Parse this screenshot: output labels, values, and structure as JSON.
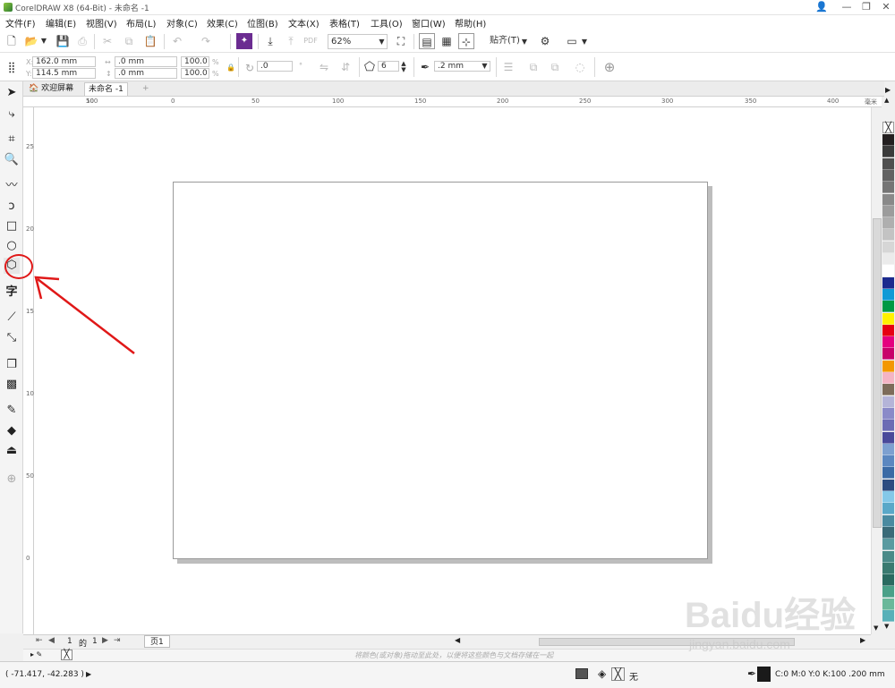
{
  "titlebar": {
    "title": "CorelDRAW X8 (64-Bit) - 未命名 -1",
    "btn_user": "👤",
    "btn_min": "—",
    "btn_restore": "❐",
    "btn_close": "✕"
  },
  "menu": [
    "文件(F)",
    "编辑(E)",
    "视图(V)",
    "布局(L)",
    "对象(C)",
    "效果(C)",
    "位图(B)",
    "文本(X)",
    "表格(T)",
    "工具(O)",
    "窗口(W)",
    "帮助(H)"
  ],
  "toolbar": {
    "zoom": "62%",
    "snap": "贴齐(T)"
  },
  "propbar": {
    "x": "162.0 mm",
    "y": "114.5 mm",
    "w": ".0 mm",
    "h": ".0 mm",
    "sx": "100.0",
    "sy": "100.0",
    "pct": "%",
    "angle": ".0",
    "sides": "6",
    "outline": ".2 mm",
    "x_label": "X:",
    "y_label": "Y:"
  },
  "tabs": {
    "welcome": "欢迎屏幕",
    "doc": "未命名 -1",
    "add": "+"
  },
  "ruler": {
    "h": [
      "100",
      "50",
      "0",
      "50",
      "100",
      "150",
      "200",
      "250",
      "300",
      "350",
      "400"
    ],
    "unit": "毫米",
    "v": [
      "250",
      "200",
      "150",
      "100",
      "50",
      "0"
    ]
  },
  "pagenav": {
    "current": "1",
    "of": "的",
    "total": "1",
    "page_tab": "页1"
  },
  "docpalette": {
    "hint": "将颜色(或对象)拖动至此处，以便将这些颜色与文档存储在一起"
  },
  "status": {
    "coords": "( -71.417, -42.283 )",
    "fill_none": "无",
    "color_info": "C:0 M:0 Y:0 K:100  .200 mm"
  },
  "watermark": {
    "text": "Baidu经验",
    "url": "jingyan.baidu.com"
  },
  "colors": {
    "accent": "#e01818",
    "page_bg": "#ffffff",
    "canvas_bg": "#ffffff"
  },
  "palette": [
    "#231f20",
    "#3b3b3b",
    "#4f4f4f",
    "#626262",
    "#757575",
    "#898989",
    "#9c9c9c",
    "#afafaf",
    "#c3c3c3",
    "#d6d6d6",
    "#ebebeb",
    "#ffffff",
    "#1b2a8e",
    "#0f9ad6",
    "#009944",
    "#fff100",
    "#e60012",
    "#e4007f",
    "#c8006a",
    "#f39800",
    "#f4b4c4",
    "#7d6c5a",
    "#b4b4d8",
    "#8a8ac8",
    "#6c6cb4",
    "#4a4a9a",
    "#7da0d0",
    "#5b87c0",
    "#3a6aa5",
    "#2c4c80",
    "#84c8e8",
    "#5aa8c8",
    "#4a8aa0",
    "#3a6a78",
    "#5a9aa0",
    "#4a8a88",
    "#3a7a70",
    "#2a6a60",
    "#4aa088",
    "#6ab89a",
    "#58b0b8"
  ],
  "icons": [
    "select-icon",
    "shape-icon",
    "crop-icon",
    "zoom-icon",
    "freehand-icon",
    "artistic-icon",
    "rectangle-icon",
    "ellipse-icon",
    "polygon-icon",
    "text-icon",
    "parallel-dimension-icon",
    "connector-icon",
    "drop-shadow-icon",
    "transparency-icon",
    "eyedropper-icon",
    "interactive-fill-icon",
    "smart-fill-icon",
    "add-icon"
  ]
}
